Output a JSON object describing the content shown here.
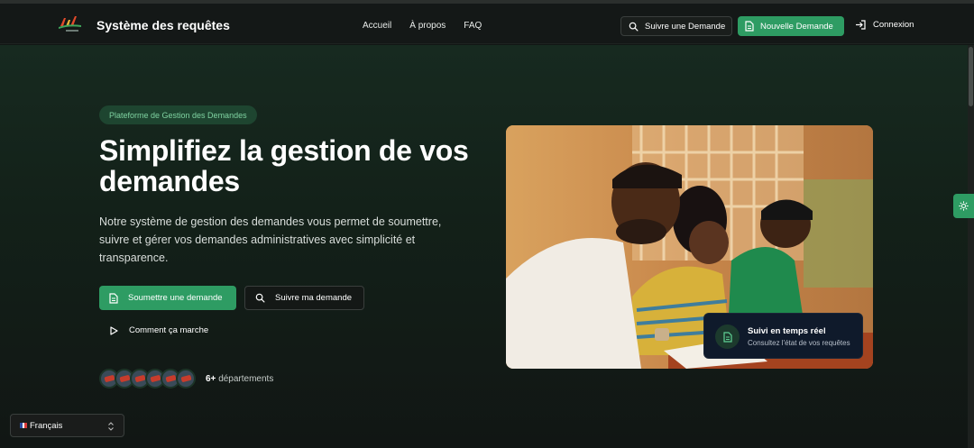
{
  "brand": {
    "title": "Système des requêtes"
  },
  "nav": {
    "links": [
      "Accueil",
      "À propos",
      "FAQ"
    ]
  },
  "header_actions": {
    "track_label": "Suivre une Demande",
    "new_label": "Nouvelle Demande",
    "login_label": "Connexion"
  },
  "hero": {
    "badge": "Plateforme de Gestion des Demandes",
    "title": "Simplifiez la gestion de vos demandes",
    "description": "Notre système de gestion des demandes vous permet de soumettre, suivre et gérer vos demandes administratives avec simplicité et transparence.",
    "submit_label": "Soumettre une demande",
    "follow_label": "Suivre ma demande",
    "howto_label": "Comment ça marche",
    "departments_count": "6+",
    "departments_label": "départements"
  },
  "feature_card": {
    "title": "Suivi en temps réel",
    "subtitle": "Consultez l'état de vos requêtes"
  },
  "language": {
    "selected": "Français"
  },
  "colors": {
    "accent": "#2e9c63",
    "badge_bg": "#1e4530",
    "badge_text": "#7fd3a1",
    "background": "#111614"
  },
  "icons": [
    "logo",
    "search-icon",
    "document-icon",
    "login-icon",
    "play-icon",
    "sun-icon",
    "chevron-updown-icon",
    "flag-icon"
  ]
}
